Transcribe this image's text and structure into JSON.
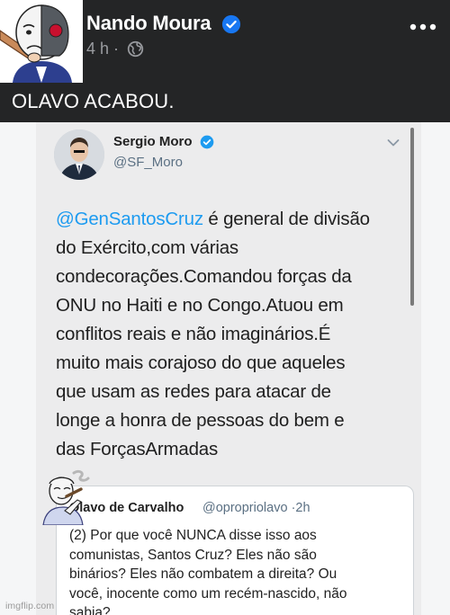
{
  "fb_post": {
    "author": "Nando Moura",
    "time": "4 h",
    "time_separator": "·",
    "caption": "OLAVO ACABOU.",
    "icons": {
      "verified": "verified-badge-icon",
      "audience": "globe-icon",
      "more": "more-options-icon"
    },
    "colors": {
      "background": "#242526",
      "verified": "#1877f2"
    }
  },
  "tweet": {
    "name": "Sergio Moro",
    "handle": "@SF_Moro",
    "icons": {
      "verified": "verified-badge-icon",
      "menu": "chevron-down-icon"
    },
    "colors": {
      "mention": "#1d9bf0",
      "verified": "#1d9bf0"
    },
    "mention": "@GenSantosCruz",
    "lines": [
      " é general de divisão",
      "do Exército,com várias",
      "condecorações.Comandou forças da",
      "ONU no Haiti e no Congo.Atuou em",
      "conflitos reais e não imaginários.É",
      "muito mais corajoso do que aqueles",
      "que usam as redes para atacar de",
      "longe a honra de pessoas do bem e",
      "das ForçasArmadas"
    ]
  },
  "reply": {
    "name": "Olavo de Carvalho",
    "handle": "@oproprio​lavo",
    "separator": "·",
    "time": "2h",
    "lines": [
      "(2) Por que você NUNCA disse isso aos",
      "comunistas, Santos Cruz? Eles não são",
      "binários? Eles não combatem a direita? Ou",
      "você, inocente como um recém-nascido, não",
      "sabia?..."
    ]
  },
  "watermark": "imgflip.com"
}
